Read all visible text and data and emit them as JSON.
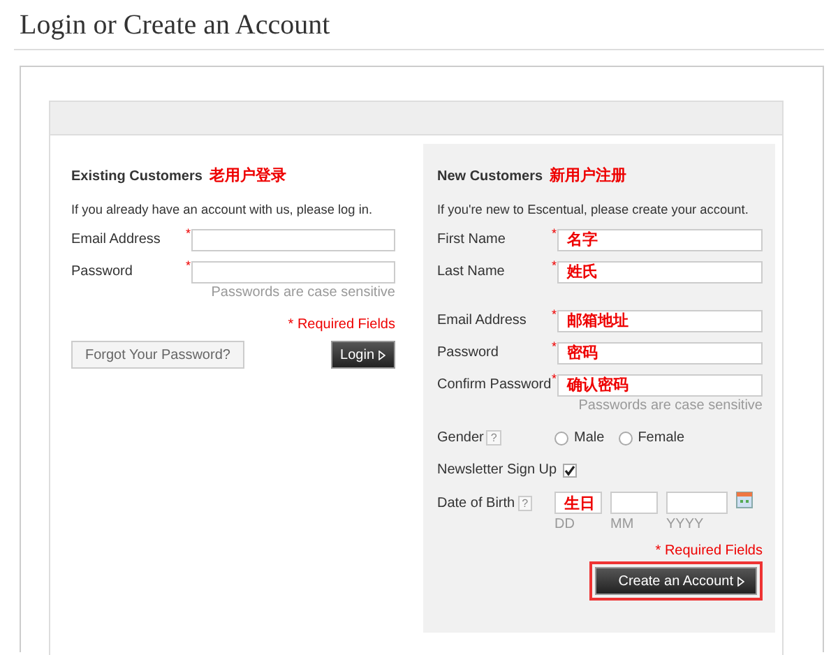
{
  "page_title": "Login or Create an Account",
  "existing": {
    "heading": "Existing Customers",
    "note": "老用户登录",
    "intro": "If you already have an account with us, please log in.",
    "fields": [
      {
        "label": "Email Address",
        "marker": "*"
      },
      {
        "label": "Password",
        "marker": "*",
        "hint": "Passwords are case sensitive"
      }
    ],
    "required_note": "* Required Fields",
    "forgot_button": "Forgot Your Password?",
    "login_button": "Login"
  },
  "new": {
    "heading": "New Customers",
    "note": "新用户注册",
    "intro": "If you're new to Escentual, please create your account.",
    "name_fields": [
      {
        "label": "First Name",
        "marker": "*",
        "note": "名字"
      },
      {
        "label": "Last Name",
        "marker": "*",
        "note": "姓氏"
      }
    ],
    "account_fields": [
      {
        "label": "Email Address",
        "marker": "*",
        "note": "邮箱地址"
      },
      {
        "label": "Password",
        "marker": "*",
        "note": "密码"
      },
      {
        "label": "Confirm Password",
        "marker": "*",
        "note": "确认密码",
        "hint": "Passwords are case sensitive"
      }
    ],
    "gender": {
      "label": "Gender",
      "help": "?",
      "options": [
        {
          "label": "Male",
          "selected": false
        },
        {
          "label": "Female",
          "selected": false
        }
      ]
    },
    "newsletter": {
      "label": "Newsletter Sign Up",
      "checked": true
    },
    "dob": {
      "label": "Date of Birth",
      "help": "?",
      "parts": [
        {
          "caption": "DD",
          "note": "生日"
        },
        {
          "caption": "MM"
        },
        {
          "caption": "YYYY"
        }
      ]
    },
    "required_note": "* Required Fields",
    "create_button": {
      "label": "Create an Account",
      "highlighted": true
    }
  }
}
